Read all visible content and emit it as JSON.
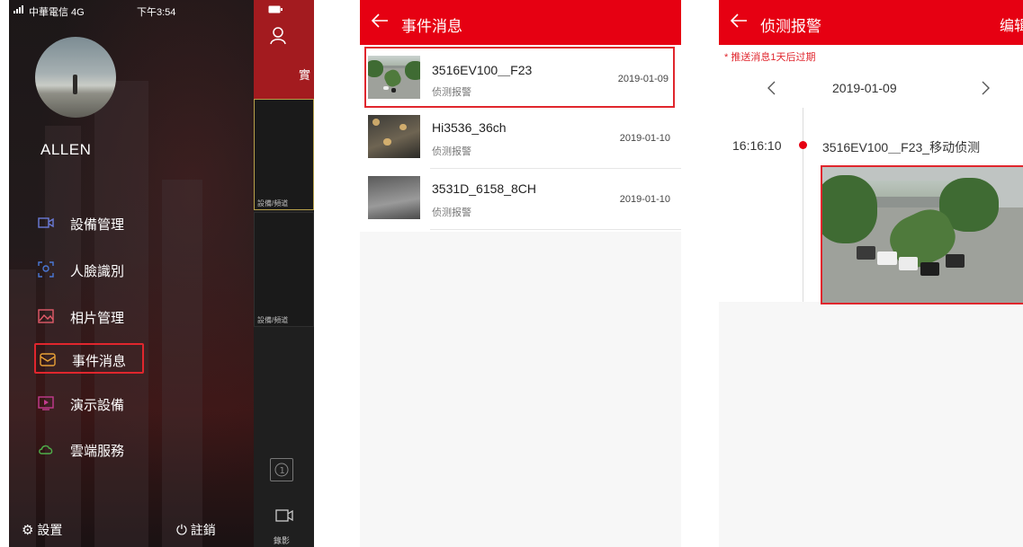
{
  "screen1": {
    "status_bar": {
      "carrier": "中華電信 4G",
      "time": "下午3:54"
    },
    "username": "ALLEN",
    "menu": [
      {
        "label": "設備管理",
        "icon": "video-camera-icon"
      },
      {
        "label": "人臉識別",
        "icon": "face-scan-icon"
      },
      {
        "label": "相片管理",
        "icon": "photo-icon"
      },
      {
        "label": "事件消息",
        "icon": "envelope-icon",
        "highlighted": true
      },
      {
        "label": "演示設備",
        "icon": "play-screen-icon"
      },
      {
        "label": "雲端服務",
        "icon": "cloud-icon"
      }
    ],
    "footer": {
      "settings_label": "設置",
      "logout_label": "註銷"
    },
    "side_panel": {
      "tab_label": "實",
      "pane_caption_1": "設備/頻道",
      "pane_caption_2": "設備/頻道",
      "record_label": "錄影"
    }
  },
  "screen2": {
    "title": "事件消息",
    "events": [
      {
        "name": "3516EV100＿F23",
        "type": "侦测报警",
        "date": "2019-01-09",
        "highlighted": true
      },
      {
        "name": "Hi3536_36ch",
        "type": "侦测报警",
        "date": "2019-01-10",
        "highlighted": false
      },
      {
        "name": "3531D_6158_8CH",
        "type": "侦测报警",
        "date": "2019-01-10",
        "highlighted": false
      }
    ]
  },
  "screen3": {
    "title": "侦测报警",
    "edit_label": "编辑",
    "notice": "* 推送消息1天后过期",
    "current_date": "2019-01-09",
    "event": {
      "time": "16:16:10",
      "name": "3516EV100＿F23_移动侦测"
    }
  },
  "colors": {
    "brand_red": "#e60012",
    "highlight_border": "#e0262d",
    "drawer_bg": "#141112"
  }
}
